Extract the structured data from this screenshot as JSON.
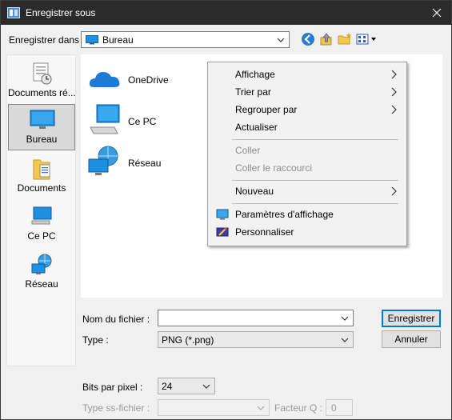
{
  "window": {
    "title": "Enregistrer sous",
    "title_bg": "#2b2b2b",
    "accent": "#0078d7"
  },
  "lookin": {
    "label": "Enregistrer dans :",
    "value": "Bureau"
  },
  "toolbar": {
    "icons": [
      "back-icon",
      "up-folder-icon",
      "new-folder-icon",
      "view-menu-icon"
    ]
  },
  "places": [
    {
      "label": "Documents ré...",
      "icon": "recent-documents-icon"
    },
    {
      "label": "Bureau",
      "icon": "desktop-icon",
      "selected": true
    },
    {
      "label": "Documents",
      "icon": "documents-folder-icon"
    },
    {
      "label": "Ce PC",
      "icon": "computer-icon"
    },
    {
      "label": "Réseau",
      "icon": "network-icon"
    }
  ],
  "files": [
    {
      "label": "OneDrive",
      "icon": "onedrive-icon"
    },
    {
      "label": "Ce PC",
      "icon": "computer-icon"
    },
    {
      "label": "Réseau",
      "icon": "network-icon"
    }
  ],
  "context_menu": {
    "view": "Affichage",
    "sort": "Trier par",
    "group": "Regrouper par",
    "refresh": "Actualiser",
    "paste": "Coller",
    "paste_shortcut": "Coller le raccourci",
    "new": "Nouveau",
    "display_settings": "Paramètres d'affichage",
    "personalize": "Personnaliser"
  },
  "form": {
    "filename_label": "Nom du fichier :",
    "filename_value": "",
    "type_label": "Type :",
    "type_value": "PNG (*.png)",
    "bits_label": "Bits par pixel :",
    "bits_value": "24",
    "subtype_label": "Type ss-fichier :",
    "subtype_value": "",
    "quality_label": "Facteur Q :",
    "quality_value": "0"
  },
  "buttons": {
    "save": "Enregistrer",
    "cancel": "Annuler"
  }
}
